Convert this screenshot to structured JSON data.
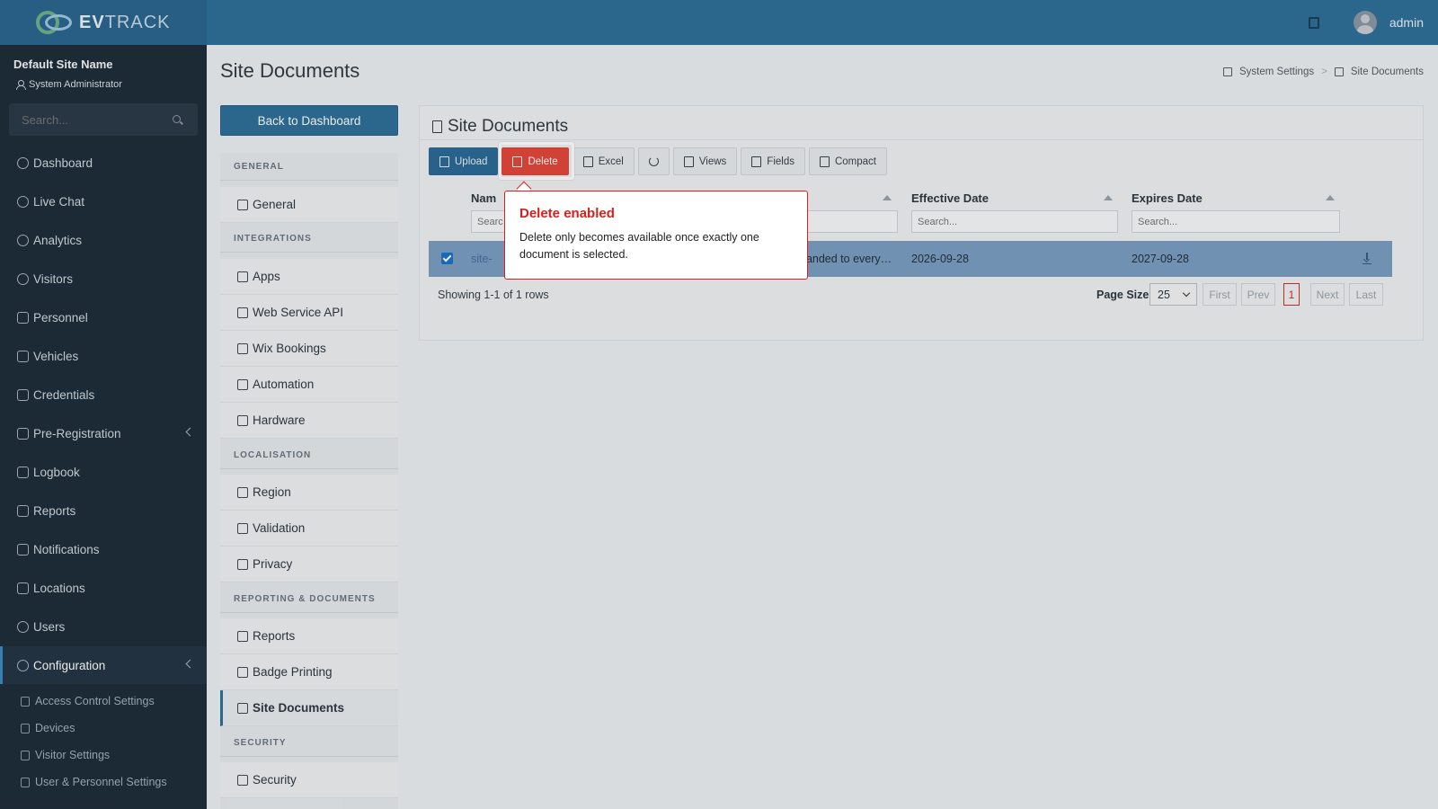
{
  "brand": {
    "logo_text_bold": "EV",
    "logo_text_thin": "TRACK"
  },
  "topbar": {
    "user": "admin"
  },
  "sidebar": {
    "site_name": "Default Site Name",
    "role": "System Administrator",
    "search_placeholder": "Search...",
    "items": [
      {
        "label": "Dashboard",
        "icon": "dashboard-icon"
      },
      {
        "label": "Live Chat",
        "icon": "headset-icon"
      },
      {
        "label": "Analytics",
        "icon": "analytics-icon"
      },
      {
        "label": "Visitors",
        "icon": "eye-icon"
      },
      {
        "label": "Personnel",
        "icon": "personnel-icon"
      },
      {
        "label": "Vehicles",
        "icon": "car-icon"
      },
      {
        "label": "Credentials",
        "icon": "credential-icon"
      },
      {
        "label": "Pre-Registration",
        "icon": "exchange-icon"
      },
      {
        "label": "Logbook",
        "icon": "book-icon"
      },
      {
        "label": "Reports",
        "icon": "chart-icon"
      },
      {
        "label": "Notifications",
        "icon": "chat-icon"
      },
      {
        "label": "Locations",
        "icon": "map-icon"
      },
      {
        "label": "Users",
        "icon": "users-icon"
      },
      {
        "label": "Configuration",
        "icon": "gear-icon"
      }
    ],
    "sub_items": [
      {
        "label": "Access Control Settings",
        "icon": "lock-icon"
      },
      {
        "label": "Devices",
        "icon": "gear-icon"
      },
      {
        "label": "Visitor Settings",
        "icon": "eye-icon"
      },
      {
        "label": "User & Personnel Settings",
        "icon": "users-icon"
      }
    ]
  },
  "page": {
    "title": "Site Documents",
    "breadcrumb": [
      "System Settings",
      "Site Documents"
    ],
    "back_button": "Back to Dashboard"
  },
  "settings_menu": {
    "sections": [
      {
        "label": "GENERAL"
      },
      {
        "label": "INTEGRATIONS"
      },
      {
        "label": "LOCALISATION"
      },
      {
        "label": "REPORTING & DOCUMENTS"
      },
      {
        "label": "SECURITY"
      }
    ],
    "items": [
      {
        "label": "General",
        "icon": "list-icon"
      },
      {
        "label": "Apps",
        "icon": "grid-icon"
      },
      {
        "label": "Web Service API",
        "icon": "api-icon"
      },
      {
        "label": "Wix Bookings",
        "icon": "calendar-icon"
      },
      {
        "label": "Automation",
        "icon": "bolt-icon"
      },
      {
        "label": "Hardware",
        "icon": "hardware-icon"
      },
      {
        "label": "Region",
        "icon": "globe-icon"
      },
      {
        "label": "Validation",
        "icon": "check-circle-icon"
      },
      {
        "label": "Privacy",
        "icon": "shield-icon"
      },
      {
        "label": "Reports",
        "icon": "bar-chart-icon"
      },
      {
        "label": "Badge Printing",
        "icon": "printer-icon"
      },
      {
        "label": "Site Documents",
        "icon": "document-icon"
      },
      {
        "label": "Security",
        "icon": "lock-icon"
      }
    ]
  },
  "panel": {
    "title": "Site Documents",
    "toolbar": {
      "upload": "Upload",
      "delete": "Delete",
      "excel": "Excel",
      "views": "Views",
      "fields": "Fields",
      "compact": "Compact"
    },
    "columns": {
      "name": "Nam",
      "effective": "Effective Date",
      "expires": "Expires Date"
    },
    "search_placeholder": "Search...",
    "name_search_partial": "Searc",
    "row": {
      "name": "site-",
      "description": "handed to every…",
      "effective": "2026-09-28",
      "expires": "2027-09-28"
    },
    "showing": "Showing 1-1 of 1 rows",
    "page_size_label": "Page Size",
    "page_size": "25",
    "pagination": {
      "first": "First",
      "prev": "Prev",
      "current": "1",
      "next": "Next",
      "last": "Last"
    }
  },
  "tooltip": {
    "title": "Delete enabled",
    "body": "Delete only becomes available once exactly one document is selected."
  }
}
